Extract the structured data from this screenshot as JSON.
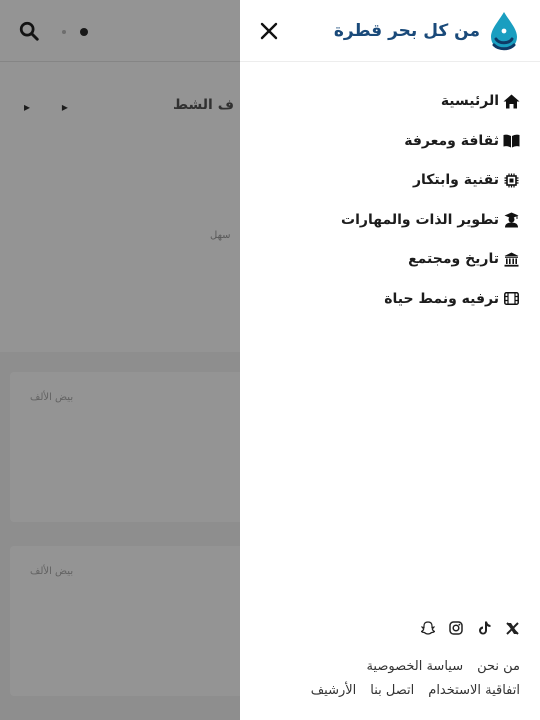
{
  "brand": {
    "name": "من كل بحر قطرة",
    "primary_color": "#1a4a7a",
    "drop_color": "#1a9ec0"
  },
  "header": {
    "close_icon": "close-icon"
  },
  "menu": {
    "items": [
      {
        "label": "الرئيسية",
        "icon": "home-icon"
      },
      {
        "label": "ثقافة ومعرفة",
        "icon": "book-icon"
      },
      {
        "label": "تقنية وابتكار",
        "icon": "chip-icon"
      },
      {
        "label": "تطوير الذات والمهارات",
        "icon": "graduate-icon"
      },
      {
        "label": "تاريخ ومجتمع",
        "icon": "landmark-icon"
      },
      {
        "label": "ترفيه ونمط حياة",
        "icon": "film-icon"
      }
    ]
  },
  "social": [
    "x-icon",
    "tiktok-icon",
    "instagram-icon",
    "snapchat-icon"
  ],
  "footer": {
    "row1": [
      "من نحن",
      "سياسة الخصوصية"
    ],
    "row2": [
      "اتفاقية الاستخدام",
      "اتصل بنا",
      "الأرشيف"
    ]
  },
  "background": {
    "search_icon": "search-icon",
    "title": "ف الشطي",
    "small_text": "سهل",
    "card_placeholder": "بيض الألف"
  }
}
